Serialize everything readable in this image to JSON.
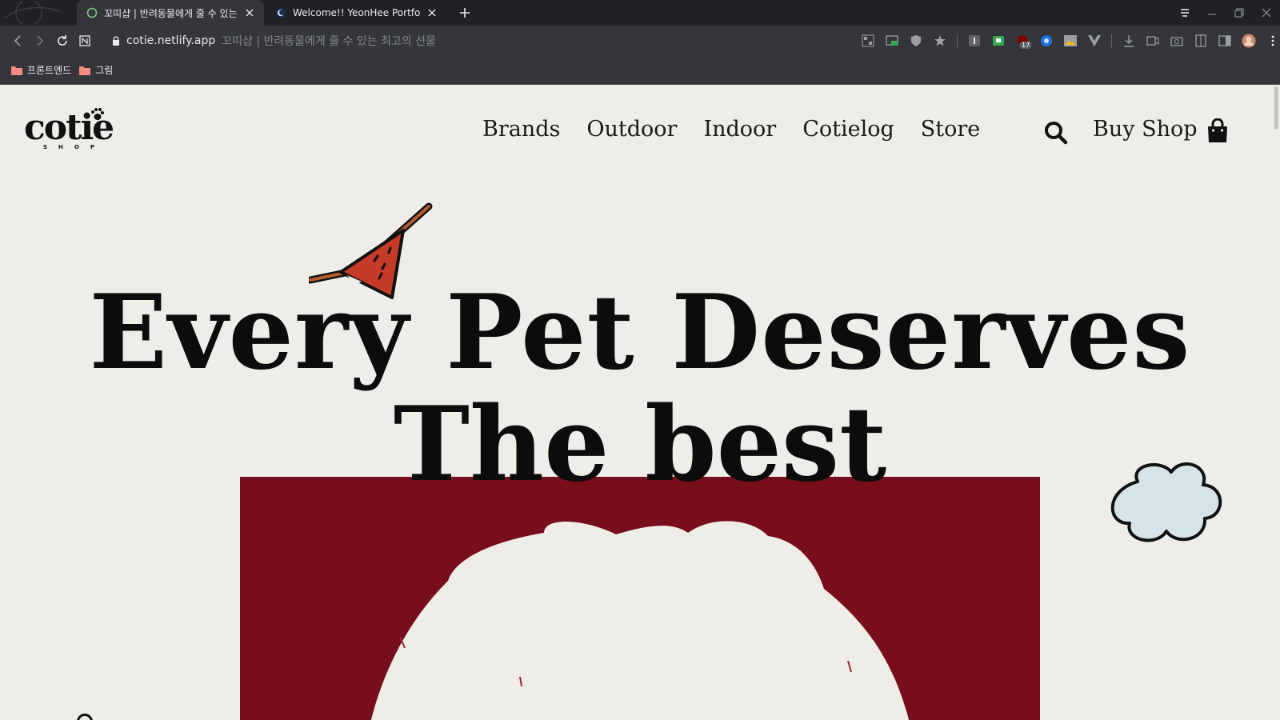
{
  "browser": {
    "tabs": [
      {
        "title": "꼬띠샵 | 반려동물에게 줄 수 있는 최고의 선물",
        "active": true
      },
      {
        "title": "Welcome!! YeonHee Portfolio!",
        "active": false
      }
    ],
    "url_host": "cotie.netlify.app",
    "page_title": "꼬띠샵 | 반려동물에게 줄 수 있는 최고의 선물",
    "extension_badge": "17",
    "bookmarks": [
      {
        "label": "프론트엔드"
      },
      {
        "label": "그림"
      }
    ]
  },
  "site": {
    "logo": {
      "word": "cotie",
      "sub": "SHOP"
    },
    "nav": [
      {
        "label": "Brands"
      },
      {
        "label": "Outdoor"
      },
      {
        "label": "Indoor"
      },
      {
        "label": "Cotielog"
      },
      {
        "label": "Store"
      }
    ],
    "buy_shop_label": "Buy Shop",
    "hero": {
      "line1": "Every Pet Deserves",
      "line2": "The best"
    }
  },
  "colors": {
    "page_background": "#efede8",
    "hero_box": "#780d1c",
    "text": "#0c0c0c",
    "chrome_dark": "#202124",
    "chrome_toolbar": "#35363a",
    "bookmark_folder": "#f28b82"
  },
  "icons": [
    "search-icon",
    "shopping-bag-icon",
    "paw-icon",
    "lock-icon",
    "back-icon",
    "forward-icon",
    "reload-icon",
    "folder-icon"
  ]
}
